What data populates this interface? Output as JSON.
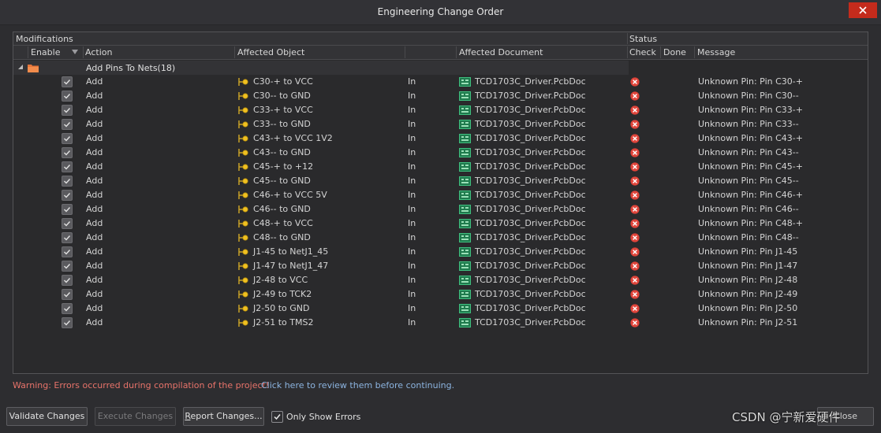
{
  "window": {
    "title": "Engineering Change Order"
  },
  "columns": {
    "group_modifications": "Modifications",
    "group_status": "Status",
    "enable": "Enable",
    "action": "Action",
    "affected_object": "Affected Object",
    "affected_document": "Affected Document",
    "check": "Check",
    "done": "Done",
    "message": "Message"
  },
  "group": {
    "label": "Add Pins To Nets(18)"
  },
  "rows": [
    {
      "action": "Add",
      "object": "C30-+ to VCC",
      "direction": "In",
      "document": "TCD1703C_Driver.PcbDoc",
      "message": "Unknown Pin: Pin C30-+"
    },
    {
      "action": "Add",
      "object": "C30-- to GND",
      "direction": "In",
      "document": "TCD1703C_Driver.PcbDoc",
      "message": "Unknown Pin: Pin C30--"
    },
    {
      "action": "Add",
      "object": "C33-+ to VCC",
      "direction": "In",
      "document": "TCD1703C_Driver.PcbDoc",
      "message": "Unknown Pin: Pin C33-+"
    },
    {
      "action": "Add",
      "object": "C33-- to GND",
      "direction": "In",
      "document": "TCD1703C_Driver.PcbDoc",
      "message": "Unknown Pin: Pin C33--"
    },
    {
      "action": "Add",
      "object": "C43-+ to VCC 1V2",
      "direction": "In",
      "document": "TCD1703C_Driver.PcbDoc",
      "message": "Unknown Pin: Pin C43-+"
    },
    {
      "action": "Add",
      "object": "C43-- to GND",
      "direction": "In",
      "document": "TCD1703C_Driver.PcbDoc",
      "message": "Unknown Pin: Pin C43--"
    },
    {
      "action": "Add",
      "object": "C45-+ to +12",
      "direction": "In",
      "document": "TCD1703C_Driver.PcbDoc",
      "message": "Unknown Pin: Pin C45-+"
    },
    {
      "action": "Add",
      "object": "C45-- to GND",
      "direction": "In",
      "document": "TCD1703C_Driver.PcbDoc",
      "message": "Unknown Pin: Pin C45--"
    },
    {
      "action": "Add",
      "object": "C46-+ to VCC 5V",
      "direction": "In",
      "document": "TCD1703C_Driver.PcbDoc",
      "message": "Unknown Pin: Pin C46-+"
    },
    {
      "action": "Add",
      "object": "C46-- to GND",
      "direction": "In",
      "document": "TCD1703C_Driver.PcbDoc",
      "message": "Unknown Pin: Pin C46--"
    },
    {
      "action": "Add",
      "object": "C48-+ to VCC",
      "direction": "In",
      "document": "TCD1703C_Driver.PcbDoc",
      "message": "Unknown Pin: Pin C48-+"
    },
    {
      "action": "Add",
      "object": "C48-- to GND",
      "direction": "In",
      "document": "TCD1703C_Driver.PcbDoc",
      "message": "Unknown Pin: Pin C48--"
    },
    {
      "action": "Add",
      "object": "J1-45 to NetJ1_45",
      "direction": "In",
      "document": "TCD1703C_Driver.PcbDoc",
      "message": "Unknown Pin: Pin J1-45"
    },
    {
      "action": "Add",
      "object": "J1-47 to NetJ1_47",
      "direction": "In",
      "document": "TCD1703C_Driver.PcbDoc",
      "message": "Unknown Pin: Pin J1-47"
    },
    {
      "action": "Add",
      "object": "J2-48 to VCC",
      "direction": "In",
      "document": "TCD1703C_Driver.PcbDoc",
      "message": "Unknown Pin: Pin J2-48"
    },
    {
      "action": "Add",
      "object": "J2-49 to TCK2",
      "direction": "In",
      "document": "TCD1703C_Driver.PcbDoc",
      "message": "Unknown Pin: Pin J2-49"
    },
    {
      "action": "Add",
      "object": "J2-50 to GND",
      "direction": "In",
      "document": "TCD1703C_Driver.PcbDoc",
      "message": "Unknown Pin: Pin J2-50"
    },
    {
      "action": "Add",
      "object": "J2-51 to TMS2",
      "direction": "In",
      "document": "TCD1703C_Driver.PcbDoc",
      "message": "Unknown Pin: Pin J2-51"
    }
  ],
  "footer": {
    "warning": "Warning: Errors occurred during compilation of the project!",
    "review_link": "Click here to review them before continuing."
  },
  "buttons": {
    "validate": "Validate Changes",
    "execute": "Execute Changes",
    "report_underlined": "R",
    "report_rest": "eport Changes...",
    "only_show_errors": "Only Show Errors",
    "close": "Close"
  },
  "watermark": "CSDN @宁新爱硬件",
  "colors": {
    "error": "#e0443a",
    "warning_text": "#e8736a",
    "link": "#8cb4e0",
    "close_button": "#c42b1c"
  }
}
